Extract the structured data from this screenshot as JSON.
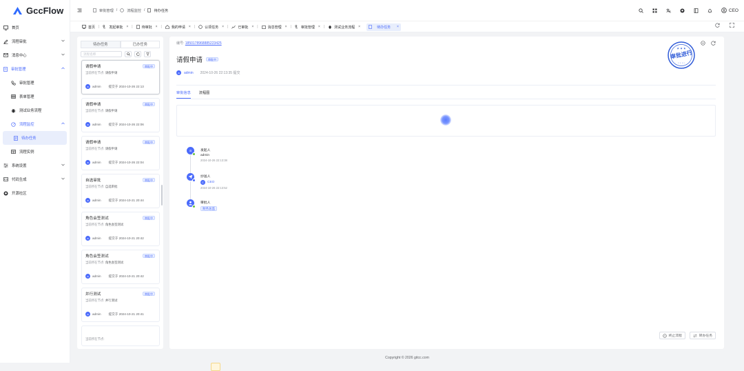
{
  "app": {
    "name": "GccFlow",
    "brand_color": "#2f6bff"
  },
  "sidebar": {
    "items": [
      {
        "label": "首页",
        "icon": "monitor-icon"
      },
      {
        "label": "流程审批",
        "icon": "pen-icon"
      },
      {
        "label": "消息中心",
        "icon": "mail-icon"
      },
      {
        "label": "审批管理",
        "icon": "doc-icon"
      },
      {
        "label": "审批管理",
        "icon": "flow-icon"
      },
      {
        "label": "表单管理",
        "icon": "grid-icon"
      },
      {
        "label": "测试业务流程",
        "icon": "bug-icon"
      },
      {
        "label": "流程监控",
        "icon": "gauge-icon"
      },
      {
        "label": "待办任务",
        "icon": "list-icon"
      },
      {
        "label": "流程实例",
        "icon": "table-icon"
      },
      {
        "label": "系统设置",
        "icon": "sliders-icon"
      },
      {
        "label": "代码生成",
        "icon": "code-icon"
      },
      {
        "label": "开源社区",
        "icon": "github-icon"
      }
    ]
  },
  "header": {
    "breadcrumb": [
      "审批管理",
      "流程监控",
      "待办任务"
    ],
    "user": "CEO"
  },
  "tabs": [
    {
      "label": "首页",
      "closable": false
    },
    {
      "label": "发起审批",
      "closable": true
    },
    {
      "label": "待审批",
      "closable": true
    },
    {
      "label": "我的申请",
      "closable": true
    },
    {
      "label": "认领任务",
      "closable": true
    },
    {
      "label": "已审批",
      "closable": true
    },
    {
      "label": "消息管理",
      "closable": true
    },
    {
      "label": "审批管理",
      "closable": true
    },
    {
      "label": "测试业务流程",
      "closable": true
    },
    {
      "label": "待办任务",
      "closable": true,
      "active": true
    }
  ],
  "list": {
    "tab_todo": "待办任务",
    "tab_done": "已办任务",
    "search_placeholder": "流程名称",
    "cards": [
      {
        "title": "请假申请",
        "badge": "审批中",
        "node_label": "当前所在节点:",
        "node": "请假申请",
        "user": "admin",
        "submitted": "提交于 2024-10-26 22:13"
      },
      {
        "title": "请假申请",
        "badge": "审批中",
        "node_label": "当前所在节点:",
        "node": "请假申请",
        "user": "admin",
        "submitted": "提交于 2024-10-26 22:06"
      },
      {
        "title": "请假申请",
        "badge": "审批中",
        "node_label": "当前所在节点:",
        "node": "请假申请",
        "user": "admin",
        "submitted": "提交于 2024-10-26 22:04"
      },
      {
        "title": "自选审批",
        "badge": "审批中",
        "node_label": "当前所在节点:",
        "node": "自选审批",
        "user": "admin",
        "submitted": "提交于 2024-10-21 20:44"
      },
      {
        "title": "角色会签测试",
        "badge": "审批中",
        "node_label": "当前所在节点:",
        "node": "角色会签测试",
        "user": "admin",
        "submitted": "提交于 2024-10-21 20:42"
      },
      {
        "title": "角色会签测试",
        "badge": "审批中",
        "node_label": "当前所在节点:",
        "node": "角色会签测试",
        "user": "admin",
        "submitted": "提交于 2024-10-21 20:42"
      },
      {
        "title": "并行测试",
        "badge": "审批中",
        "node_label": "当前所在节点:",
        "node": "并行测试",
        "user": "admin",
        "submitted": "提交于 2024-10-21 20:41"
      }
    ],
    "partial_node_label": "当前所在节点:"
  },
  "detail": {
    "number_label": "编号:",
    "number": "1850178968885223425",
    "title": "请假申请",
    "badge": "审批中",
    "user": "admin",
    "submitted": "2024-10-26 22:13:35 提交",
    "tab_info": "审批信息",
    "tab_flow": "流程图",
    "stamp": "审批进行",
    "timeline": [
      {
        "role": "发起人",
        "name": "admin",
        "time": "2024-10-26 22:13:38"
      },
      {
        "role": "抄送人",
        "name": "CEO",
        "time": "2024-10-26 22:13:52"
      },
      {
        "role": "审批人",
        "name": "财务总监",
        "time": ""
      }
    ],
    "btn_stop": "终止流程",
    "btn_transfer": "转办任务"
  },
  "footer": {
    "text": "Copyright © 2026 gitcc.com"
  }
}
